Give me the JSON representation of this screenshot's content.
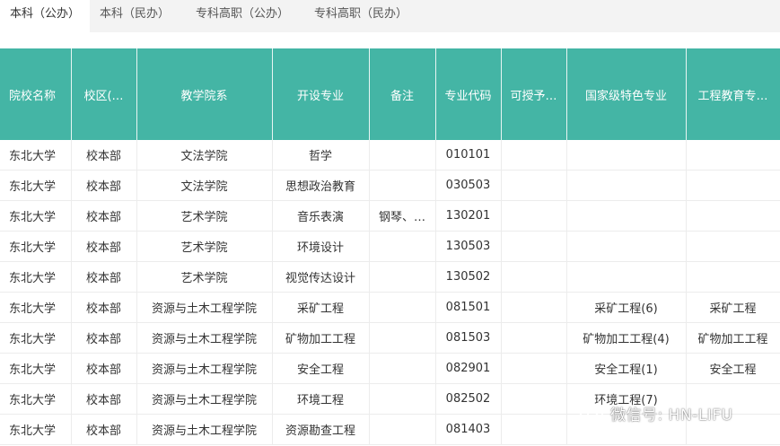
{
  "tabs": [
    {
      "label": "本科（公办）"
    },
    {
      "label": "本科（民办）"
    },
    {
      "label": "专科高职（公办）"
    },
    {
      "label": "专科高职（民办）"
    }
  ],
  "table": {
    "headers": [
      "院校名称",
      "校区(…",
      "教学院系",
      "开设专业",
      "备注",
      "专业代码",
      "可授予…",
      "国家级特色专业",
      "工程教育专…"
    ],
    "rows": [
      [
        "东北大学",
        "校本部",
        "文法学院",
        "哲学",
        "",
        "010101",
        "",
        "",
        ""
      ],
      [
        "东北大学",
        "校本部",
        "文法学院",
        "思想政治教育",
        "",
        "030503",
        "",
        "",
        ""
      ],
      [
        "东北大学",
        "校本部",
        "艺术学院",
        "音乐表演",
        "钢琴、…",
        "130201",
        "",
        "",
        ""
      ],
      [
        "东北大学",
        "校本部",
        "艺术学院",
        "环境设计",
        "",
        "130503",
        "",
        "",
        ""
      ],
      [
        "东北大学",
        "校本部",
        "艺术学院",
        "视觉传达设计",
        "",
        "130502",
        "",
        "",
        ""
      ],
      [
        "东北大学",
        "校本部",
        "资源与土木工程学院",
        "采矿工程",
        "",
        "081501",
        "",
        "采矿工程(6)",
        "采矿工程"
      ],
      [
        "东北大学",
        "校本部",
        "资源与土木工程学院",
        "矿物加工工程",
        "",
        "081503",
        "",
        "矿物加工工程(4)",
        "矿物加工工程"
      ],
      [
        "东北大学",
        "校本部",
        "资源与土木工程学院",
        "安全工程",
        "",
        "082901",
        "",
        "安全工程(1)",
        "安全工程"
      ],
      [
        "东北大学",
        "校本部",
        "资源与土木工程学院",
        "环境工程",
        "",
        "082502",
        "",
        "环境工程(7)",
        ""
      ],
      [
        "东北大学",
        "校本部",
        "资源与土木工程学院",
        "资源勘查工程",
        "",
        "081403",
        "",
        "",
        ""
      ]
    ]
  },
  "watermark": {
    "text": "微信号: HN-LIFU",
    "icon": "wechat-icon"
  },
  "colors": {
    "header_bg": "#44b5a5",
    "tab_bar_bg": "#f3f3f3"
  }
}
